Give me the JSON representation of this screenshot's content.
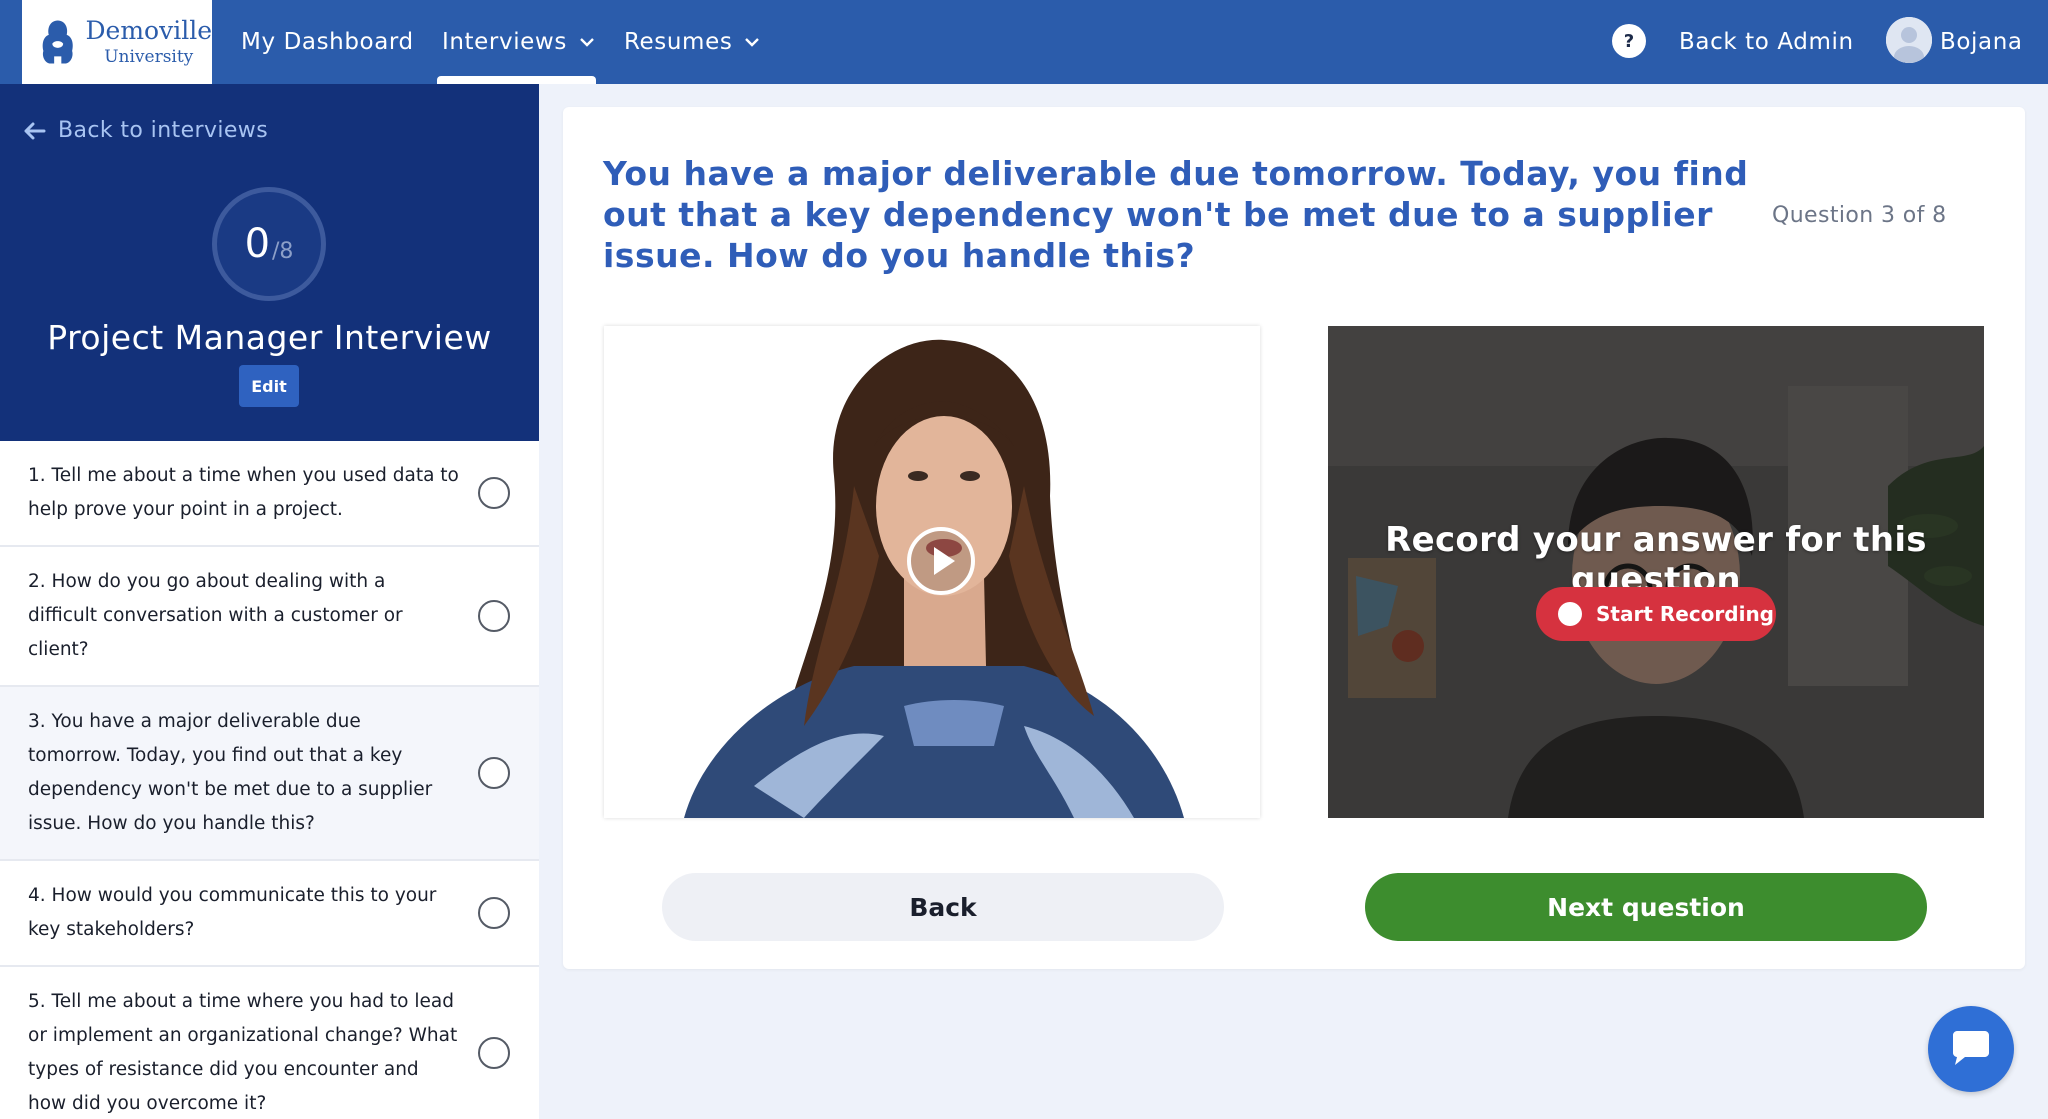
{
  "brand": {
    "name_line1": "Demoville",
    "name_line2": "University"
  },
  "nav": {
    "dashboard": "My Dashboard",
    "interviews": "Interviews",
    "resumes": "Resumes",
    "help": "?",
    "back_to_admin": "Back to Admin",
    "user_name": "Bojana"
  },
  "sidebar": {
    "back_link": "Back to interviews",
    "progress_done": "0",
    "progress_total": "/8",
    "interview_title": "Project Manager Interview",
    "edit_label": "Edit",
    "questions": [
      {
        "text": "1. Tell me about a time when you used data to help prove your point in a project."
      },
      {
        "text": "2. How do you go about dealing with a difficult conversation with a customer or client?"
      },
      {
        "text": "3. You have a major deliverable due tomorrow. Today, you find out that a key dependency won't be met due to a supplier issue. How do you handle this?"
      },
      {
        "text": "4. How would you communicate this to your key stakeholders?"
      },
      {
        "text": "5. Tell me about a time where you had to lead or implement an organizational change? What types of resistance did you encounter and how did you overcome it?"
      }
    ]
  },
  "main": {
    "question": "You have a major deliverable due tomorrow. Today, you find out that a key dependency won't be met due to a supplier issue. How do you handle this?",
    "counter": "Question 3 of 8",
    "record_title": "Record your answer for this question",
    "record_button": "Start Recording",
    "back_button": "Back",
    "next_button": "Next question"
  },
  "colors": {
    "nav_bg": "#2b5cab",
    "sidebar_head_bg": "#13317a",
    "question_color": "#2f5db8",
    "record_red": "#d6323f",
    "next_green": "#3d8d2e",
    "chat_blue": "#2f6fd6"
  },
  "icons": [
    "bear-logo-icon",
    "chevron-down-icon",
    "help-icon",
    "avatar-icon",
    "arrow-left-icon",
    "play-icon",
    "record-dot-icon",
    "chat-icon"
  ]
}
